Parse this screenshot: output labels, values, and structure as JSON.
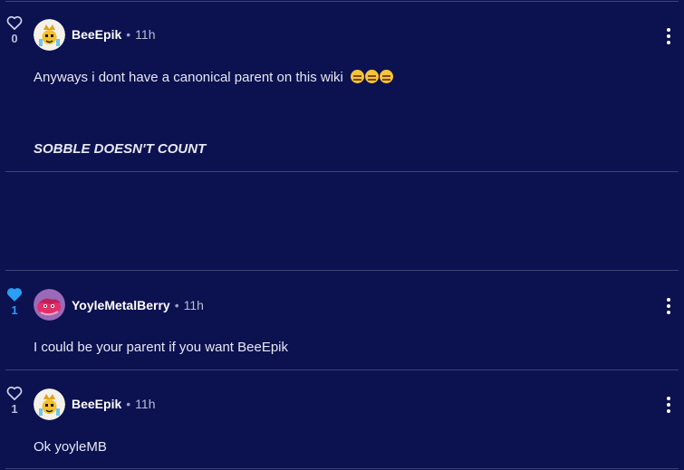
{
  "comments": [
    {
      "username": "BeeEpik",
      "time": "11h",
      "votes": "0",
      "liked": false,
      "text": "Anyways i dont have a canonical parent on this wiki",
      "emoji_count": 3,
      "emphasis": "SOBBLE DOESN'T COUNT"
    },
    {
      "username": "YoyleMetalBerry",
      "time": "11h",
      "votes": "1",
      "liked": true,
      "text": "I could be your parent if you want BeeEpik"
    },
    {
      "username": "BeeEpik",
      "time": "11h",
      "votes": "1",
      "liked": false,
      "text": "Ok yoyleMB"
    }
  ],
  "separator_dot": "•",
  "colors": {
    "background": "#0c1150",
    "divider": "#3b4475",
    "liked_heart": "#2b9ef5",
    "username": "#ffffff"
  },
  "icons": [
    "heart-outline-icon",
    "heart-filled-icon",
    "more-options-icon"
  ]
}
